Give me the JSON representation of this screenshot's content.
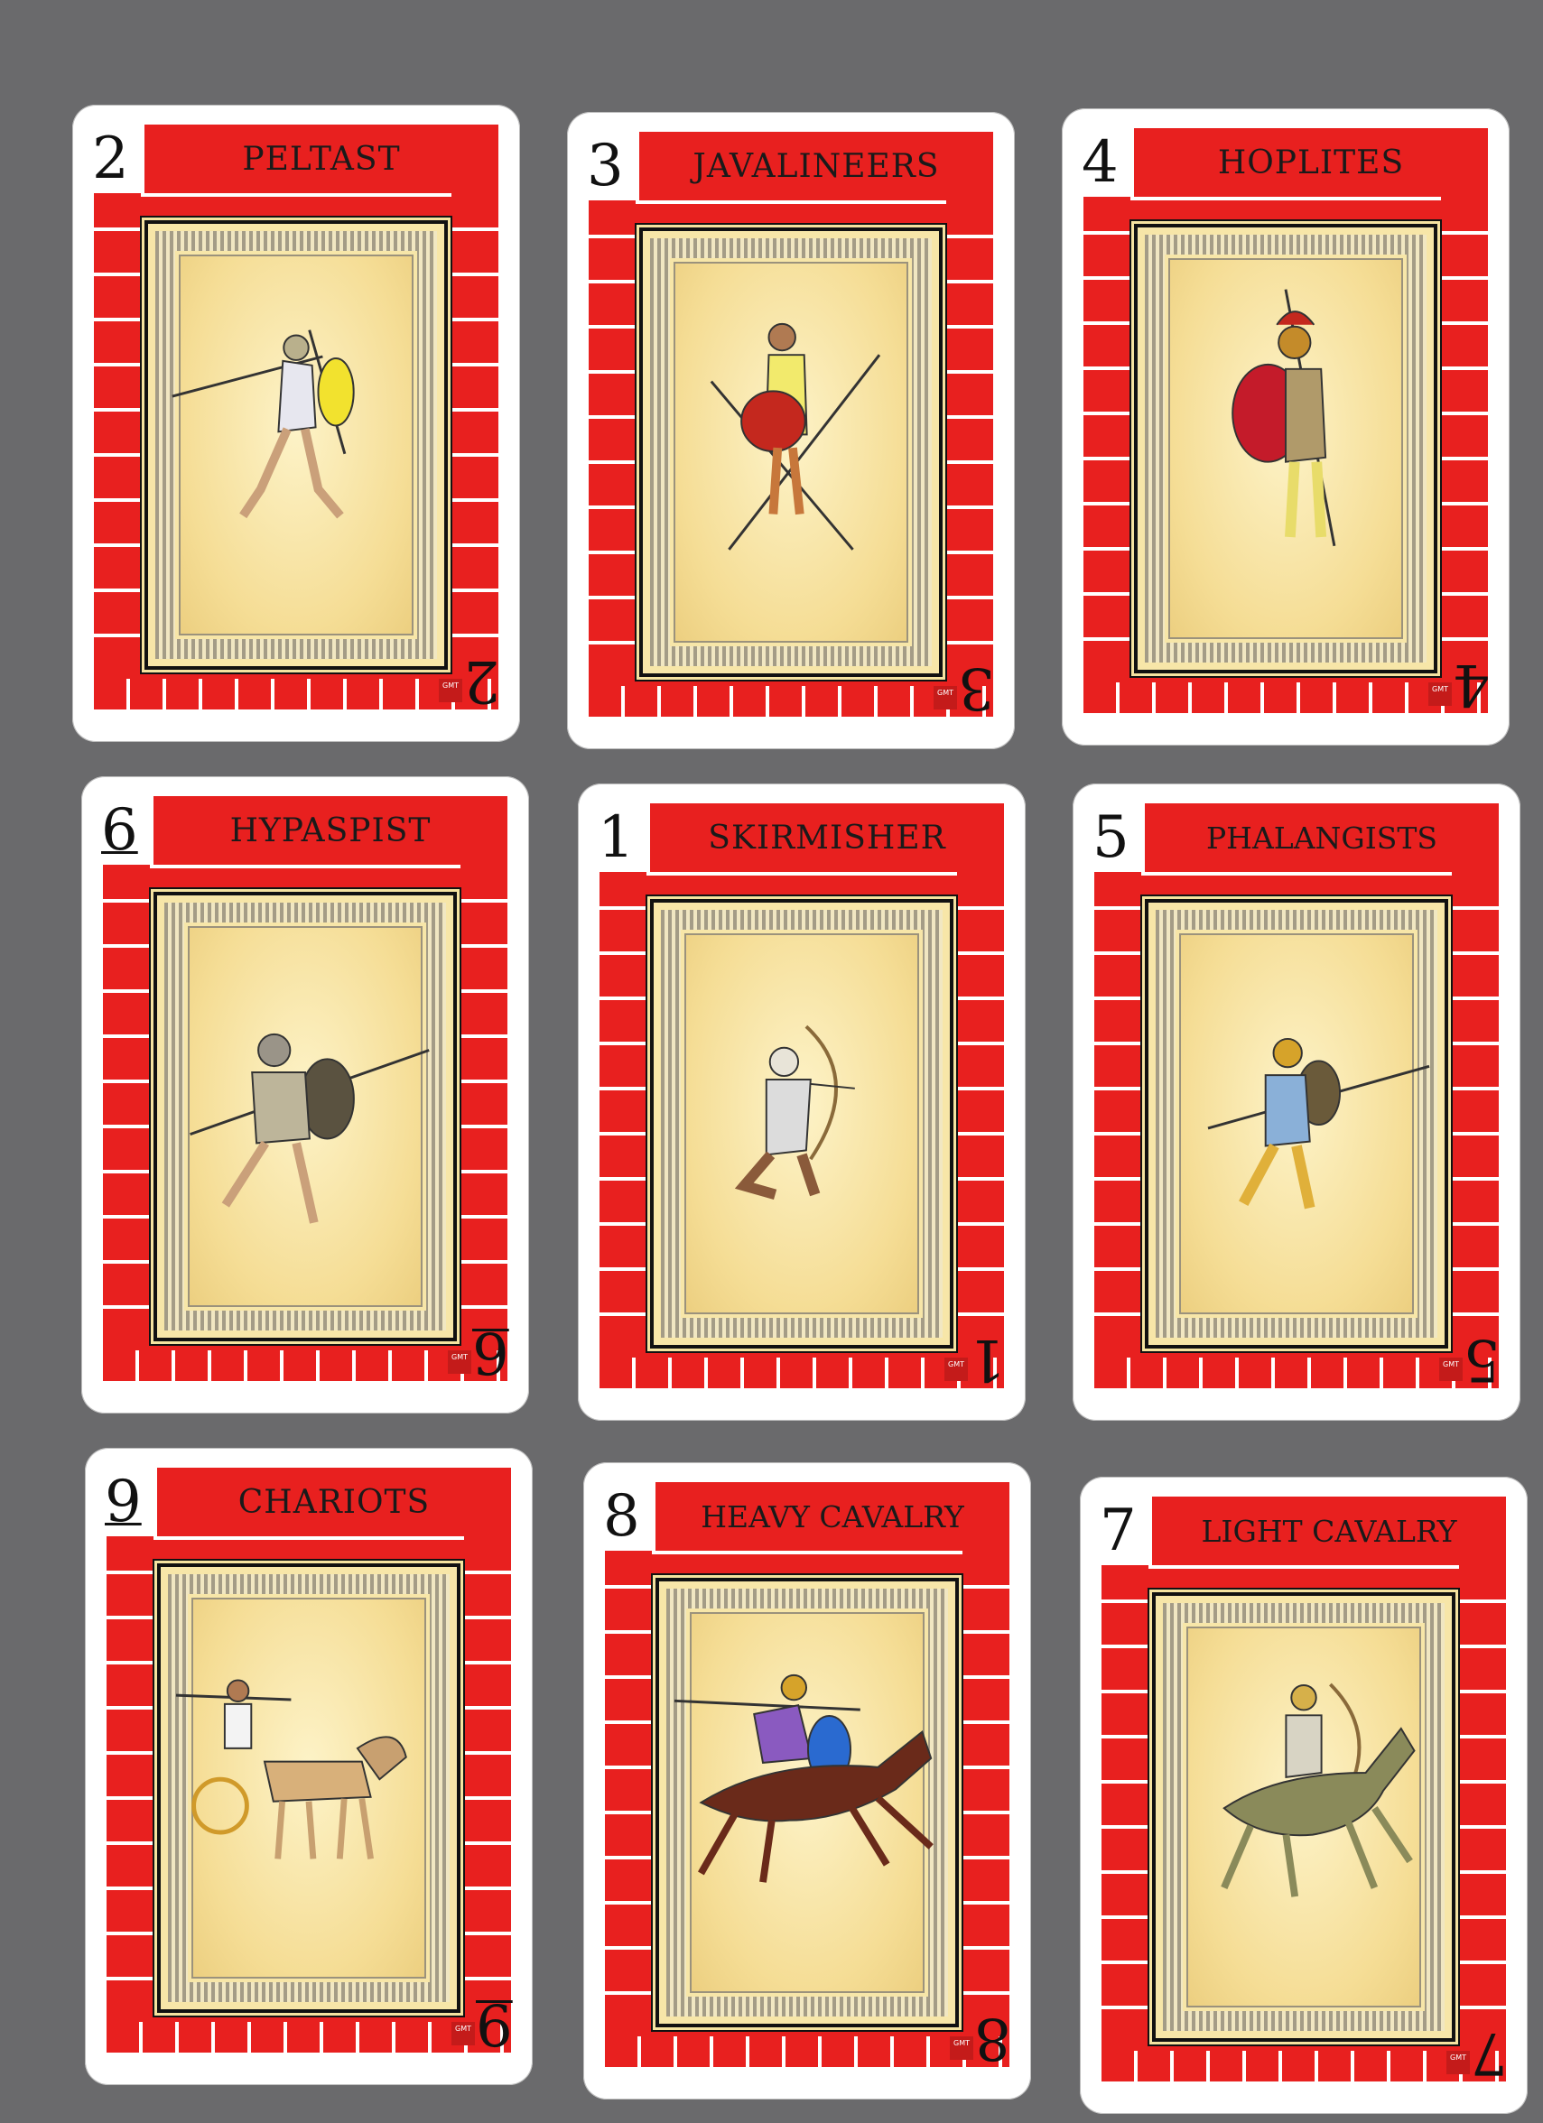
{
  "cards": [
    {
      "number": "2",
      "title": "PELTAST",
      "figure": "peltast-figure"
    },
    {
      "number": "3",
      "title": "JAVALINEERS",
      "figure": "javalineers-figure"
    },
    {
      "number": "4",
      "title": "HOPLITES",
      "figure": "hoplite-figure"
    },
    {
      "number": "6",
      "title": "HYPASPIST",
      "figure": "hypaspist-figure"
    },
    {
      "number": "1",
      "title": "SKIRMISHER",
      "figure": "skirmisher-figure"
    },
    {
      "number": "5",
      "title": "PHALANGISTS",
      "figure": "phalangist-figure"
    },
    {
      "number": "9",
      "title": "CHARIOTS",
      "figure": "chariot-figure"
    },
    {
      "number": "8",
      "title": "HEAVY CAVALRY",
      "figure": "heavy-cavalry-figure"
    },
    {
      "number": "7",
      "title": "LIGHT CAVALRY",
      "figure": "light-cavalry-figure"
    }
  ],
  "publisher_logo": "GMT GAMES",
  "colors": {
    "red": "#e8201f",
    "parchment": "#f7e6a8",
    "background": "#6a6a6c"
  }
}
